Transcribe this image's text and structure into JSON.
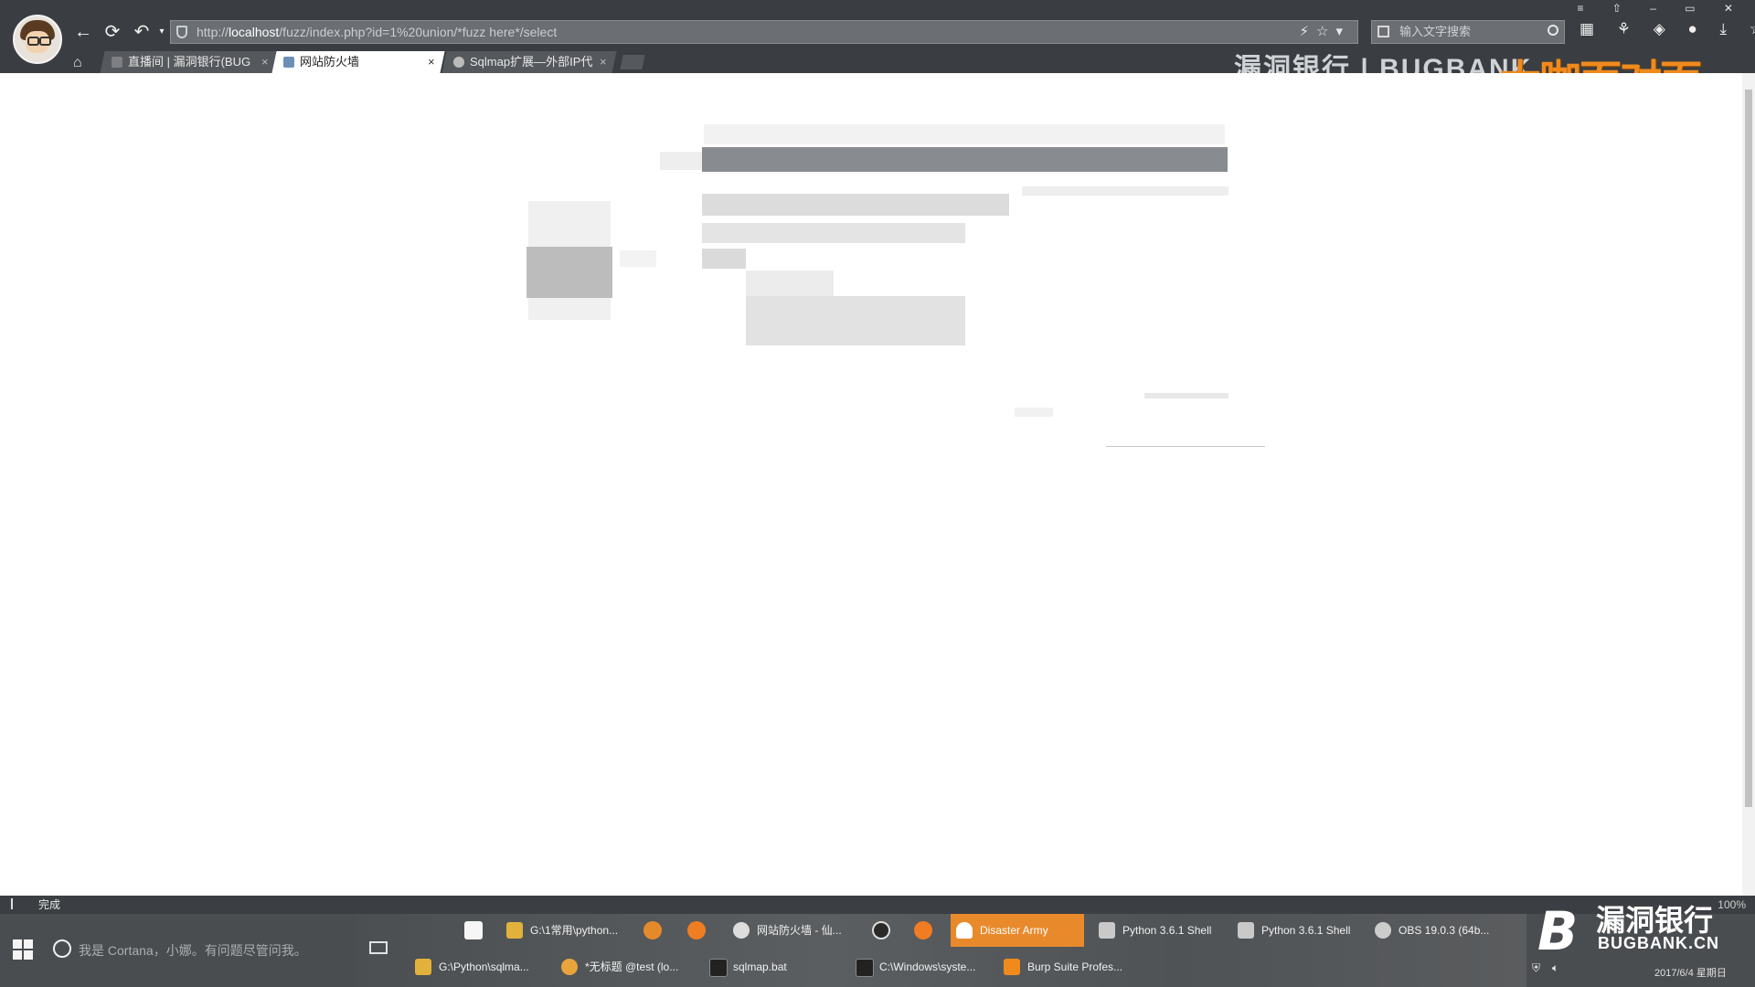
{
  "browser": {
    "address": {
      "scheme": "http://",
      "host": "localhost",
      "path": "/fuzz/index.php?id=1%20union/*fuzz here*/select"
    },
    "search_placeholder": "输入文字搜索",
    "tabs": [
      {
        "label": "直播间 | 漏洞银行(BUG",
        "active": false
      },
      {
        "label": "网站防火墙",
        "active": true
      },
      {
        "label": "Sqlmap扩展—外部IP代",
        "active": false
      }
    ],
    "brand_banner": "漏洞银行 | BUGBANK",
    "brand_overlay": "大咖面对面",
    "status_text": "完成",
    "zoom": "100%"
  },
  "taskbar": {
    "cortana_placeholder": "我是 Cortana，小娜。有问题尽管问我。",
    "row1": [
      {
        "label": "G:\\1常用\\python...",
        "icon": "folder-icon",
        "color": "#e2b13c"
      },
      {
        "label": "网站防火墙 - 仙...",
        "icon": "browser-icon",
        "color": "#dddddd"
      },
      {
        "label": "Disaster Army",
        "icon": "ghost-icon",
        "color": "#ffffff",
        "selected": true
      },
      {
        "label": "Python 3.6.1 Shell",
        "icon": "python-icon",
        "color": "#c9c9c9"
      },
      {
        "label": "Python 3.6.1 Shell",
        "icon": "python-icon",
        "color": "#c9c9c9"
      },
      {
        "label": "OBS 19.0.3 (64b...",
        "icon": "obs-icon",
        "color": "#cccccc"
      }
    ],
    "row2": [
      {
        "label": "G:\\Python\\sqlma...",
        "icon": "folder-icon",
        "color": "#e2b13c"
      },
      {
        "label": "*无标题 @test (lo...",
        "icon": "navicat-icon",
        "color": "#e9a43b"
      },
      {
        "label": "sqlmap.bat",
        "icon": "cmd-icon",
        "color": "#222222"
      },
      {
        "label": "C:\\Windows\\syste...",
        "icon": "cmd-icon",
        "color": "#222222"
      },
      {
        "label": "Burp Suite Profes...",
        "icon": "burp-icon",
        "color": "#f08a1d"
      }
    ],
    "tray_brand": "漏洞银行",
    "tray_brand_en": "BUGBANK.CN",
    "date": "2017/6/4 星期日"
  },
  "colors": {
    "chrome_bg": "#3a3d41",
    "accent": "#e88a2c",
    "taskbar_bg": "#4a4d50"
  }
}
